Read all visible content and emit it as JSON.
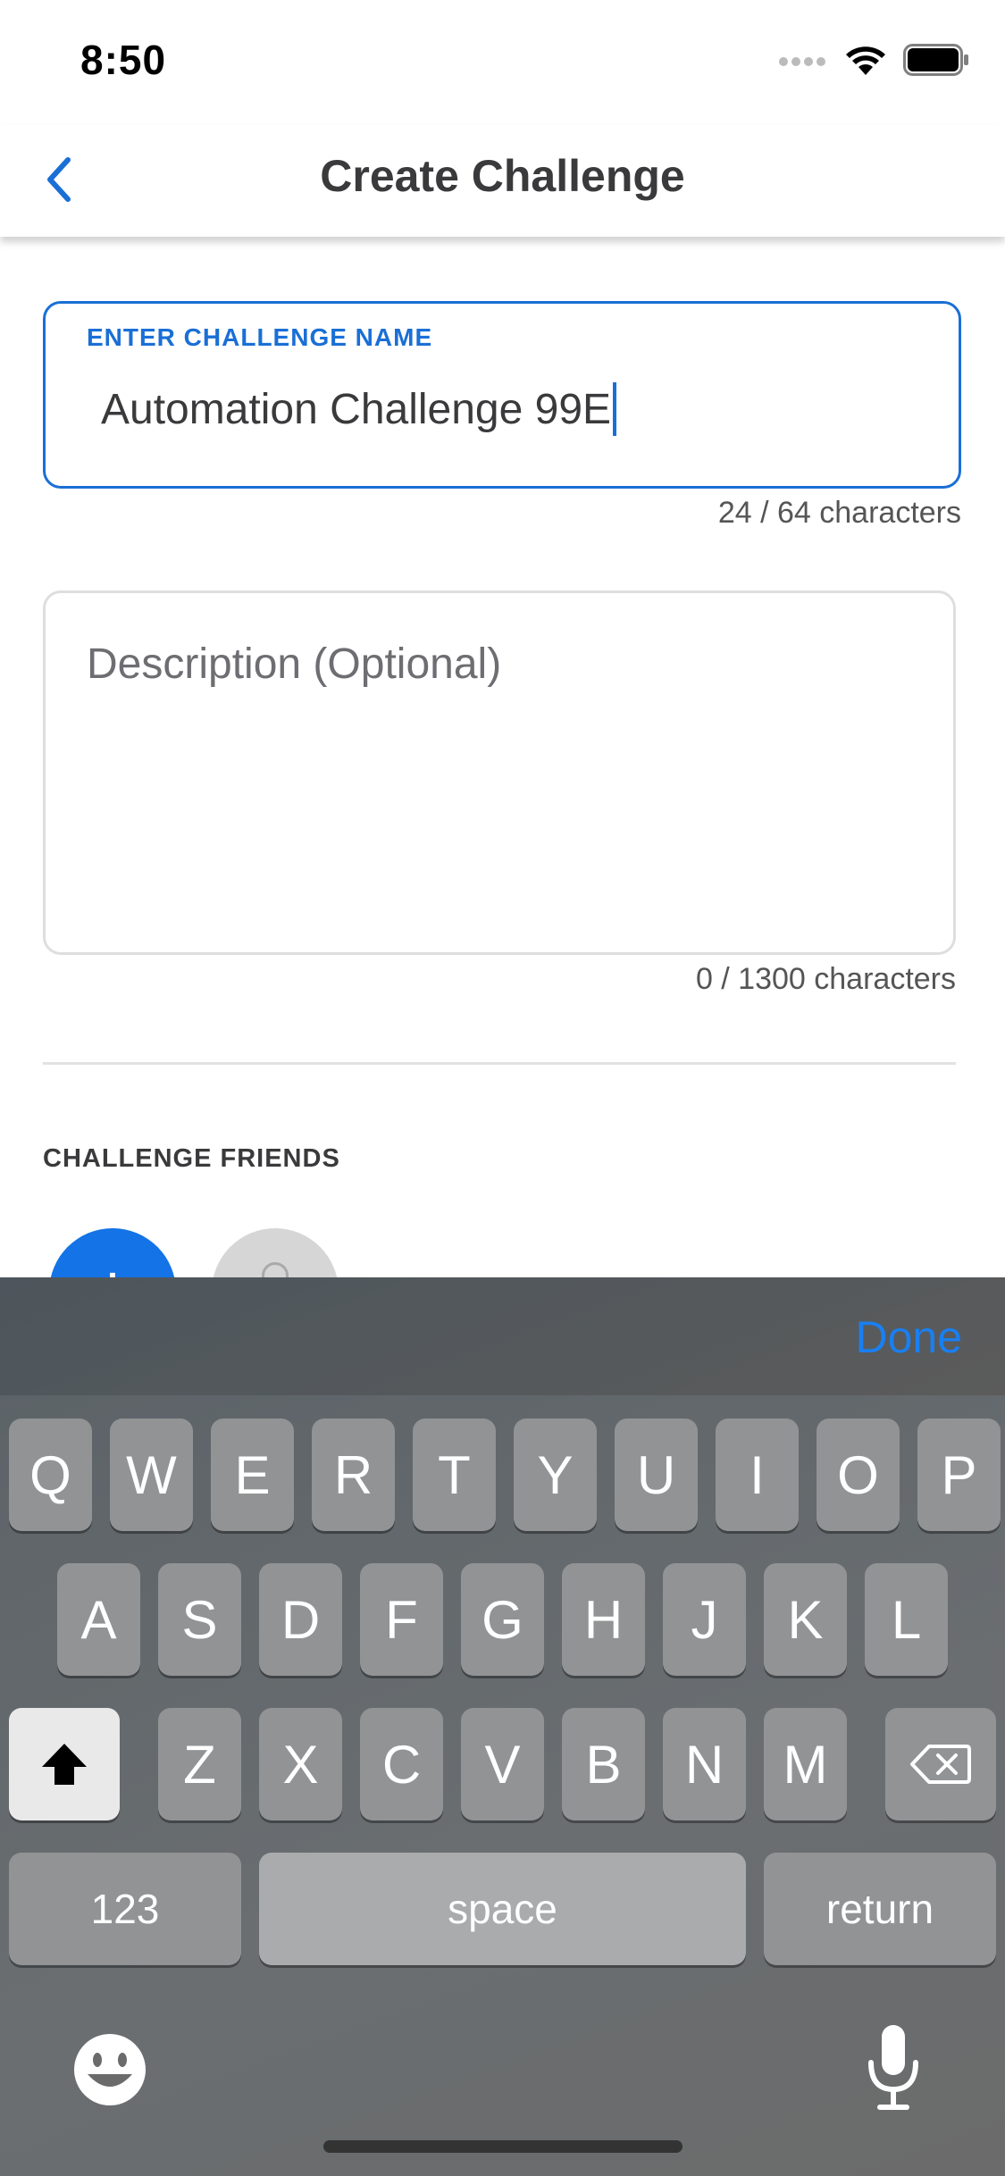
{
  "status_bar": {
    "time": "8:50"
  },
  "nav": {
    "title": "Create Challenge"
  },
  "form": {
    "name_label": "ENTER CHALLENGE NAME",
    "name_value": "Automation Challenge 99E",
    "name_counter": "24 / 64 characters",
    "description_placeholder": "Description (Optional)",
    "description_counter": "0 / 1300 characters"
  },
  "friends": {
    "heading": "CHALLENGE FRIENDS",
    "add_label": "+"
  },
  "keyboard": {
    "done_label": "Done",
    "row1": [
      "Q",
      "W",
      "E",
      "R",
      "T",
      "Y",
      "U",
      "I",
      "O",
      "P"
    ],
    "row2": [
      "A",
      "S",
      "D",
      "F",
      "G",
      "H",
      "J",
      "K",
      "L"
    ],
    "row3": [
      "Z",
      "X",
      "C",
      "V",
      "B",
      "N",
      "M"
    ],
    "numbers_label": "123",
    "space_label": "space",
    "return_label": "return"
  },
  "colors": {
    "accent": "#1a6fd6",
    "add_button": "#1473e6",
    "done": "#1a7ff0"
  }
}
